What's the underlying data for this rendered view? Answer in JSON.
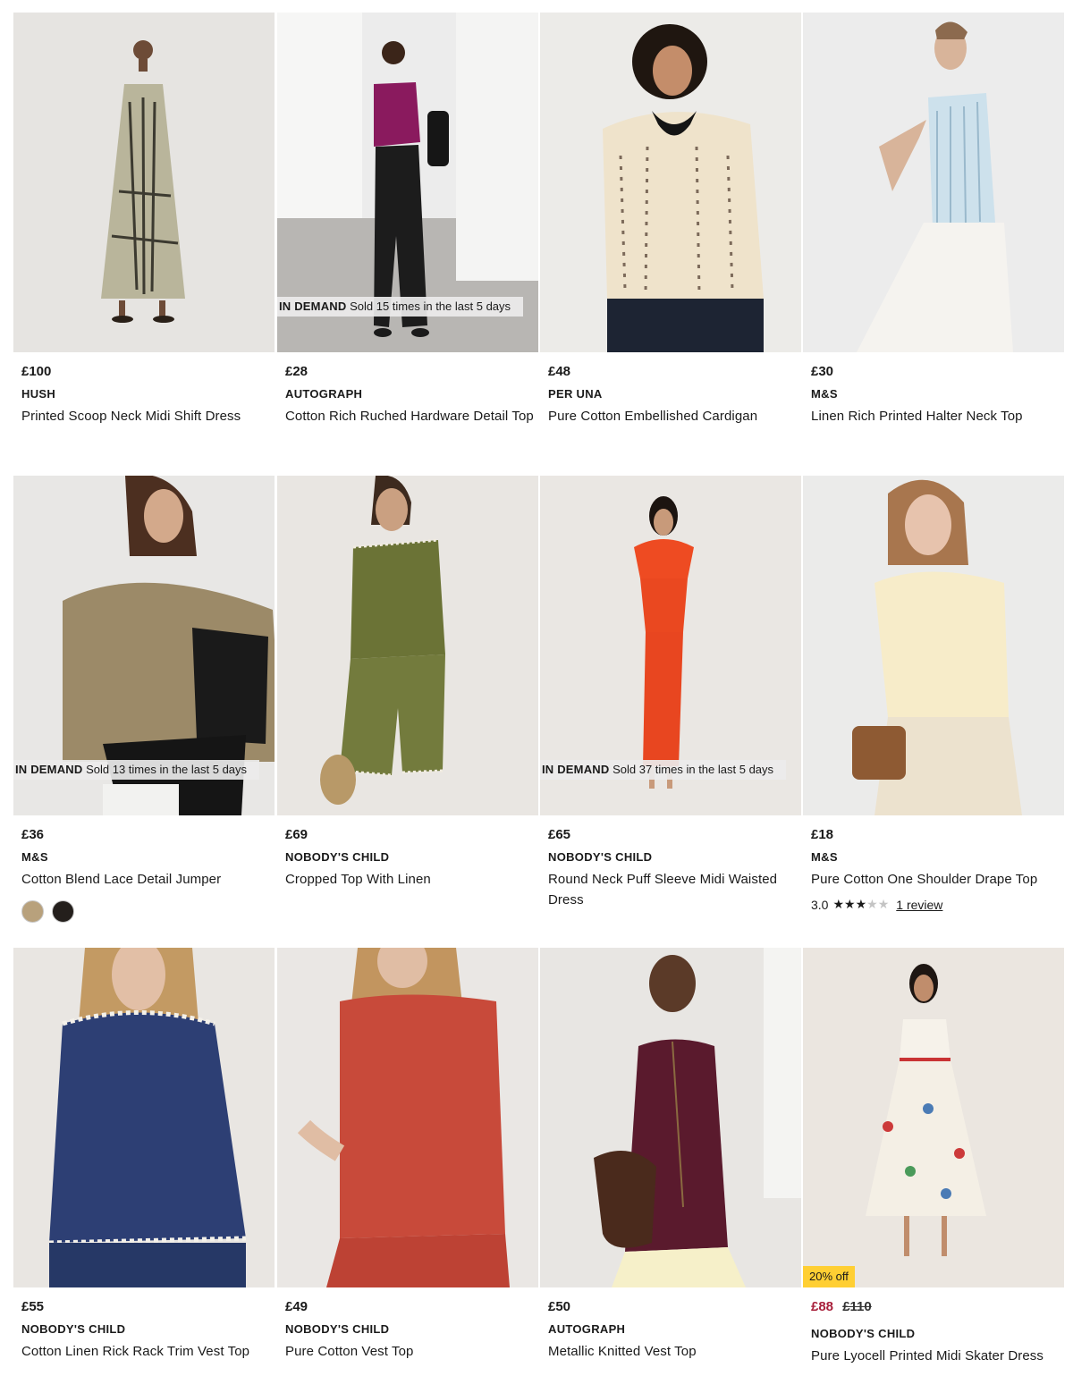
{
  "products": [
    {
      "price": "£100",
      "brand": "HUSH",
      "name": "Printed Scoop Neck Midi Shift Dress",
      "demand": null
    },
    {
      "price": "£28",
      "brand": "AUTOGRAPH",
      "name": "Cotton Rich Ruched Hardware Detail Top",
      "demand": {
        "tag": "IN DEMAND",
        "text": "Sold 15 times in the last 5 days"
      }
    },
    {
      "price": "£48",
      "brand": "PER UNA",
      "name": "Pure Cotton Embellished Cardigan",
      "demand": null
    },
    {
      "price": "£30",
      "brand": "M&S",
      "name": "Linen Rich Printed Halter Neck Top",
      "demand": null
    },
    {
      "price": "£36",
      "brand": "M&S",
      "name": "Cotton Blend Lace Detail Jumper",
      "demand": {
        "tag": "IN DEMAND",
        "text": "Sold 13 times in the last 5 days"
      },
      "swatches": [
        "#b8a17c",
        "#241f1c"
      ]
    },
    {
      "price": "£69",
      "brand": "NOBODY'S CHILD",
      "name": "Cropped Top With Linen",
      "demand": null
    },
    {
      "price": "£65",
      "brand": "NOBODY'S CHILD",
      "name": "Round Neck Puff Sleeve Midi Waisted Dress",
      "demand": {
        "tag": "IN DEMAND",
        "text": "Sold 37 times in the last 5 days"
      }
    },
    {
      "price": "£18",
      "brand": "M&S",
      "name": "Pure Cotton One Shoulder Drape Top",
      "demand": null,
      "rating": {
        "score": "3.0",
        "stars": 3,
        "out_of": 5,
        "review_text": "1 review"
      }
    },
    {
      "price": "£55",
      "brand": "NOBODY'S CHILD",
      "name": "Cotton Linen Rick Rack Trim Vest Top",
      "demand": null
    },
    {
      "price": "£49",
      "brand": "NOBODY'S CHILD",
      "name": "Pure Cotton Vest Top",
      "demand": null
    },
    {
      "price": "£50",
      "brand": "AUTOGRAPH",
      "name": "Metallic Knitted Vest Top",
      "demand": null
    },
    {
      "price": "£88",
      "old_price": "£110",
      "offer": "20% off",
      "brand": "NOBODY'S CHILD",
      "name": "Pure Lyocell Printed Midi Skater Dress",
      "demand": null
    }
  ],
  "colors": {
    "sale_price": "#a8203b",
    "offer_badge": "#ffcf33",
    "demand_badge": "#ececec"
  }
}
